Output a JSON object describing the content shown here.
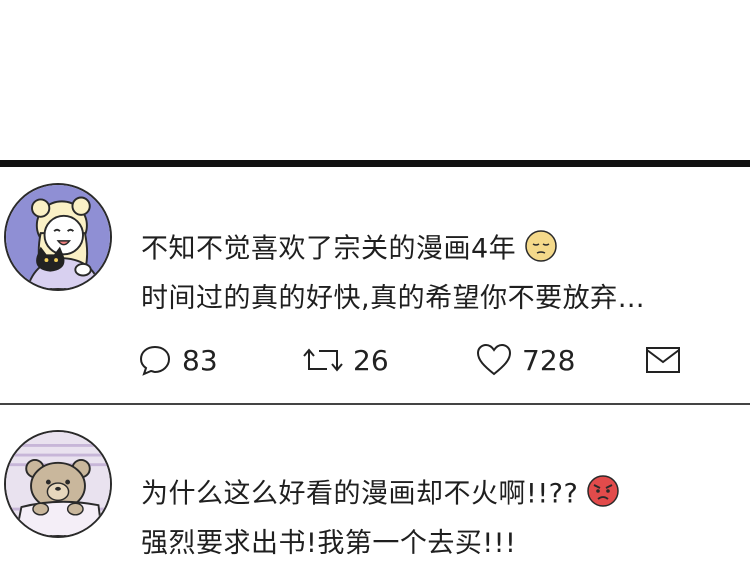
{
  "comments": [
    {
      "line1": "不知不觉喜欢了宗关的漫画4年",
      "line1_emoji": "pensive-face-icon",
      "line2": "时间过的真的好快,真的希望你不要放弃…",
      "stats": {
        "comments": "83",
        "reposts": "26",
        "likes": "728"
      }
    },
    {
      "line1": "为什么这么好看的漫画却不火啊!!??",
      "line1_emoji": "angry-face-icon",
      "line2": "强烈要求出书!我第一个去买!!!"
    }
  ],
  "colors": {
    "avatar1_bg": "#8f8fd4",
    "avatar2_bg": "#e9e2ef",
    "angry": "#e24b4b",
    "pensive": "#f4d98a"
  }
}
